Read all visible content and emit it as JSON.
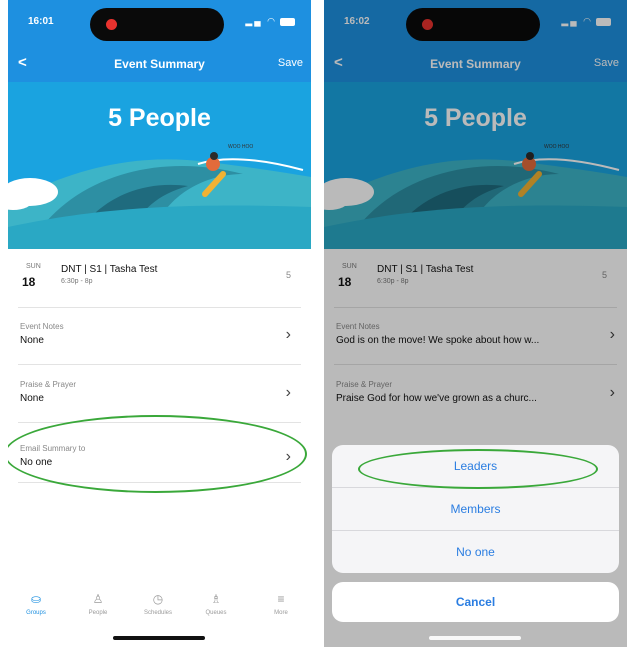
{
  "left": {
    "status_time": "16:01",
    "nav": {
      "back": "<",
      "title": "Event Summary",
      "save": "Save"
    },
    "hero": {
      "count": "5 People"
    },
    "event": {
      "dow": "SUN",
      "day": "18",
      "name": "DNT | S1 | Tasha Test",
      "time": "6:30p - 8p",
      "count": "5"
    },
    "rows": [
      {
        "label": "Event Notes",
        "value": "None"
      },
      {
        "label": "Praise & Prayer",
        "value": "None"
      },
      {
        "label": "Email Summary to",
        "value": "No one"
      }
    ],
    "tabs": [
      {
        "label": "Groups",
        "icon": "groups-icon"
      },
      {
        "label": "People",
        "icon": "people-icon"
      },
      {
        "label": "Schedules",
        "icon": "clock-icon"
      },
      {
        "label": "Queues",
        "icon": "queues-icon"
      },
      {
        "label": "More",
        "icon": "menu-icon"
      }
    ]
  },
  "right": {
    "status_time": "16:02",
    "nav": {
      "back": "<",
      "title": "Event Summary",
      "save": "Save"
    },
    "hero": {
      "count": "5 People"
    },
    "event": {
      "dow": "SUN",
      "day": "18",
      "name": "DNT | S1 | Tasha Test",
      "time": "6:30p - 8p",
      "count": "5"
    },
    "rows": [
      {
        "label": "Event Notes",
        "value": "God is on the move! We spoke about how w..."
      },
      {
        "label": "Praise & Prayer",
        "value": "Praise God for how we've grown as a churc..."
      }
    ],
    "sheet": {
      "options": [
        "Leaders",
        "Members",
        "No one"
      ],
      "cancel": "Cancel"
    }
  },
  "colors": {
    "brand": "#1e90e0",
    "hero": "#1aa3e0",
    "highlight": "#3aa83a",
    "action": "#2a7de1"
  }
}
